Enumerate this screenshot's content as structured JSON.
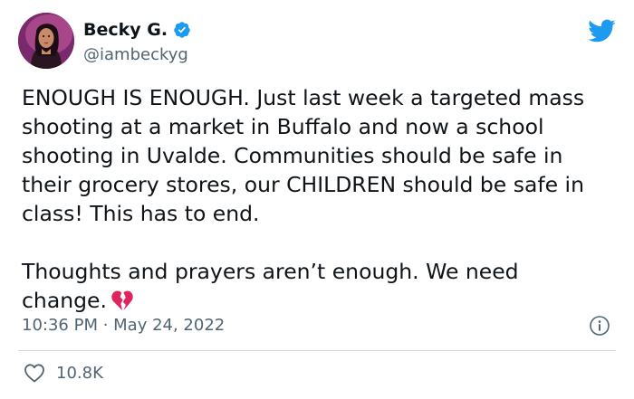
{
  "author": {
    "display_name": "Becky G.",
    "handle": "@iambeckyg",
    "verified": true
  },
  "tweet": {
    "paragraphs": [
      "ENOUGH IS ENOUGH. Just last week a targeted mass shooting at a market in Buffalo and now a school shooting in Uvalde. Communities should be safe in their grocery stores, our CHILDREN should be safe in class! This has to end.",
      "Thoughts and prayers aren’t enough. We need change."
    ],
    "emoji": "broken-heart-icon"
  },
  "meta": {
    "timestamp": "10:36 PM · May 24, 2022"
  },
  "engagement": {
    "likes": "10.8K"
  },
  "colors": {
    "twitter_blue": "#1d9bf0",
    "text_primary": "#0f1419",
    "text_secondary": "#536471",
    "broken_heart": "#e0245e"
  }
}
